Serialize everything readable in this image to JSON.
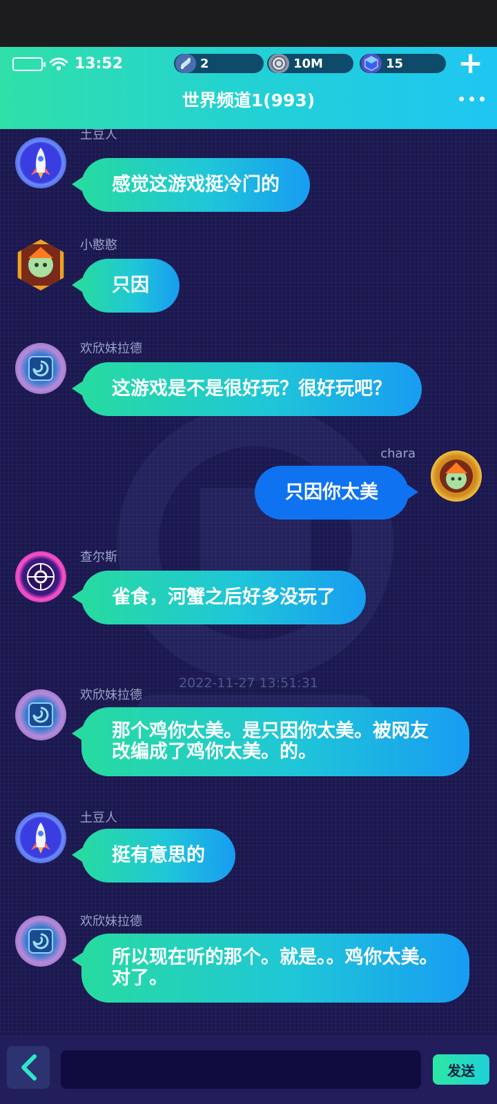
{
  "status": {
    "time": "13:52"
  },
  "resources": [
    {
      "icon": "skateboard-icon",
      "value": "2"
    },
    {
      "icon": "coin-icon",
      "value": "10M"
    },
    {
      "icon": "gem-cube-icon",
      "value": "15"
    }
  ],
  "header": {
    "title": "世界频道1(993)"
  },
  "messages": [
    {
      "name": "土豆人",
      "text": "感觉这游戏挺冷门的",
      "avatar": "rocket-avatar"
    },
    {
      "name": "小憨憨",
      "text": "只因",
      "avatar": "anime-girl-avatar"
    },
    {
      "name": "欢欣妹拉德",
      "text": "这游戏是不是很好玩？很好玩吧？",
      "avatar": "swirl-avatar"
    },
    {
      "name": "chara",
      "text": "只因你太美",
      "avatar": "anime-girl-avatar",
      "self": true
    },
    {
      "name": "查尔斯",
      "text": "雀食，河蟹之后好多没玩了",
      "avatar": "emblem-avatar"
    },
    {
      "name": "欢欣妹拉德",
      "text": "那个鸡你太美。是只因你太美。被网友\n改编成了鸡你太美。的。",
      "avatar": "swirl-avatar"
    },
    {
      "name": "土豆人",
      "text": "挺有意思的",
      "avatar": "rocket-avatar"
    },
    {
      "name": "欢欣妹拉德",
      "text": "所以现在听的那个。就是。。鸡你太美。\n对了。",
      "avatar": "swirl-avatar"
    }
  ],
  "timestamp": "2022-11-27 13:51:31",
  "input": {
    "placeholder": ""
  },
  "send_label": "发送",
  "colors": {
    "accent_start": "#27dba0",
    "accent_end": "#189cf2",
    "self_bubble": "#0f72f0",
    "background": "#1b1850"
  }
}
